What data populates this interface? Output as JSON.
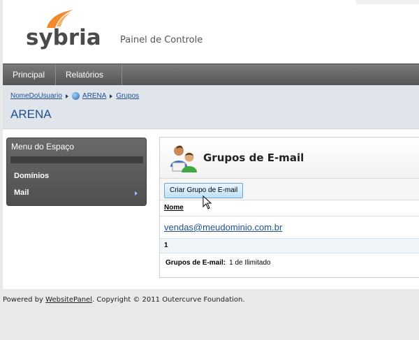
{
  "brand": {
    "logo_text": "sybria",
    "panel_title": "Painel de Controle",
    "swoosh_color": "#f08a2c"
  },
  "nav": {
    "items": [
      {
        "label": "Principal"
      },
      {
        "label": "Relatórios",
        "has_dropdown": true
      }
    ]
  },
  "breadcrumb": {
    "user": "NomeDoUsuario",
    "space": "ARENA",
    "section": "Grupos"
  },
  "space_title": "ARENA",
  "left_menu": {
    "title": "Menu do Espaço",
    "items": [
      {
        "label": "Domínios"
      },
      {
        "label": "Mail",
        "has_submenu": true
      }
    ]
  },
  "content": {
    "title": "Grupos de E-mail",
    "create_button": "Criar Grupo de E-mail",
    "column_header": "Nome",
    "rows": [
      "vendas@meudominio.com.br"
    ],
    "page": "1",
    "quota_label": "Grupos de E-mail:",
    "quota_value": "1 de Ilimitado"
  },
  "footer": {
    "prefix": "Powered by ",
    "link": "WebsitePanel",
    "suffix": ". Copyright © 2011 Outercurve Foundation."
  }
}
